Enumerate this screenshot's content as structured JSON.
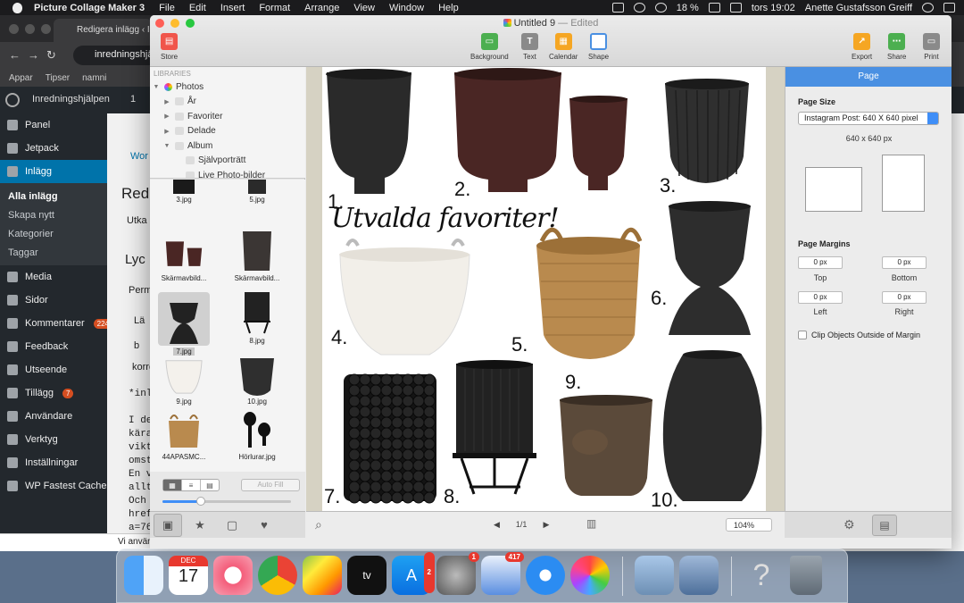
{
  "menubar": {
    "app_name": "Picture Collage Maker 3",
    "menus": [
      "File",
      "Edit",
      "Insert",
      "Format",
      "Arrange",
      "View",
      "Window",
      "Help"
    ],
    "battery": "18 %",
    "clock": "tors 19:02",
    "user": "Anette Gustafsson Greiff"
  },
  "browser": {
    "tab_title": "Redigera inlägg ‹ In",
    "url": "inredningshjä",
    "bookmarks": [
      "Appar",
      "Tipser",
      "namni"
    ],
    "admin_site": "Inredningshjälpen",
    "admin_update": "1",
    "sidebar": [
      {
        "label": "Panel"
      },
      {
        "label": "Jetpack"
      },
      {
        "label": "Inlägg",
        "active": true
      },
      {
        "label": "Alla inlägg",
        "sub": true,
        "current": true
      },
      {
        "label": "Skapa nytt",
        "sub": true
      },
      {
        "label": "Kategorier",
        "sub": true
      },
      {
        "label": "Taggar",
        "sub": true
      },
      {
        "label": "Media"
      },
      {
        "label": "Sidor"
      },
      {
        "label": "Kommentarer",
        "badge": "224"
      },
      {
        "label": "Feedback"
      },
      {
        "label": "Utseende"
      },
      {
        "label": "Tillägg",
        "badge": "7"
      },
      {
        "label": "Användare"
      },
      {
        "label": "Verktyg"
      },
      {
        "label": "Inställningar"
      },
      {
        "label": "WP Fastest Cache"
      }
    ],
    "main_fragments": [
      "Wor",
      "Redi",
      "Utka",
      "Lyc",
      "Perm",
      "Lä",
      "b",
      "i",
      "korre",
      "*inl",
      "I de",
      "kära",
      "vikt",
      "omst",
      "En v",
      "allt",
      "Och",
      "href",
      "a=76"
    ],
    "footer_fragment": "Vi använd"
  },
  "window": {
    "title": "Untitled 9",
    "status": "— Edited"
  },
  "toolbar": {
    "store": "Store",
    "background": "Background",
    "text": "Text",
    "calendar": "Calendar",
    "shape": "Shape",
    "export": "Export",
    "share": "Share",
    "print": "Print"
  },
  "library": {
    "header": "LIBRARIES",
    "tree": [
      {
        "label": "Photos",
        "level": 0,
        "expanded": true
      },
      {
        "label": "År",
        "level": 1
      },
      {
        "label": "Favoriter",
        "level": 1
      },
      {
        "label": "Delade",
        "level": 1
      },
      {
        "label": "Album",
        "level": 1,
        "expanded": true
      },
      {
        "label": "Självporträtt",
        "level": 2
      },
      {
        "label": "Live Photo-bilder",
        "level": 2
      }
    ],
    "thumbnails": [
      {
        "name": "3.jpg",
        "kind": "bubble"
      },
      {
        "name": "5.jpg",
        "kind": "pot"
      },
      {
        "name": "Skärmavbild...",
        "kind": "redpots"
      },
      {
        "name": "Skärmavbild...",
        "kind": "copper"
      },
      {
        "name": "7.jpg",
        "kind": "hourglass",
        "selected": true
      },
      {
        "name": "8.jpg",
        "kind": "stand"
      },
      {
        "name": "9.jpg",
        "kind": "white"
      },
      {
        "name": "10.jpg",
        "kind": "ribbed"
      },
      {
        "name": "44APASMC...",
        "kind": "basket"
      },
      {
        "name": "Hörlurar.jpg",
        "kind": "earbuds"
      }
    ],
    "autofill": "Auto Fill",
    "zoom_fraction": 0.3
  },
  "canvas": {
    "title": "Utvalda favoriter!",
    "labels": [
      "1.",
      "2.",
      "3.",
      "4.",
      "5.",
      "6.",
      "7.",
      "8.",
      "9.",
      "10."
    ],
    "page_indicator": "1/1",
    "zoom": "104%"
  },
  "inspector": {
    "tab": "Page",
    "page_size_label": "Page Size",
    "page_size_value": "Instagram Post: 640 X 640 pixel",
    "dimensions": "640 x 640 px",
    "margins_label": "Page Margins",
    "margin_top": "0 px",
    "margin_bottom": "0 px",
    "margin_left": "0 px",
    "margin_right": "0 px",
    "top": "Top",
    "bottom": "Bottom",
    "left": "Left",
    "right": "Right",
    "clip_label": "Clip Objects Outside of Margin"
  },
  "dock": {
    "calendar_month": "DEC",
    "calendar_day": "17",
    "appstore_badge": "2",
    "prefs_badge": "1",
    "mail_badge": "417",
    "help_glyph": "?"
  },
  "colors": {
    "accent": "#4a90e2",
    "wp_active": "#0073aa",
    "canvas_bg": "#d6d2c3"
  }
}
